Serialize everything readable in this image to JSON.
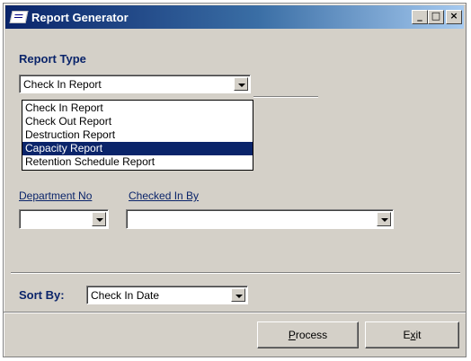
{
  "window": {
    "title": "Report Generator",
    "minimize": "_",
    "maximize": "□",
    "close": "×"
  },
  "report_type": {
    "label": "Report Type",
    "selected": "Check In Report",
    "options": [
      "Check In Report",
      "Check Out Report",
      "Destruction Report",
      "Capacity Report",
      "Retention Schedule Report"
    ],
    "highlighted_index": 3
  },
  "filters": {
    "department_label": "Department No",
    "department_value": "",
    "checked_in_by_label": "Checked In By",
    "checked_in_by_value": ""
  },
  "sort": {
    "label": "Sort By:",
    "value": "Check In Date"
  },
  "buttons": {
    "process_mnemonic": "P",
    "process_rest": "rocess",
    "exit_pre": "E",
    "exit_mnemonic": "x",
    "exit_rest": "it"
  }
}
